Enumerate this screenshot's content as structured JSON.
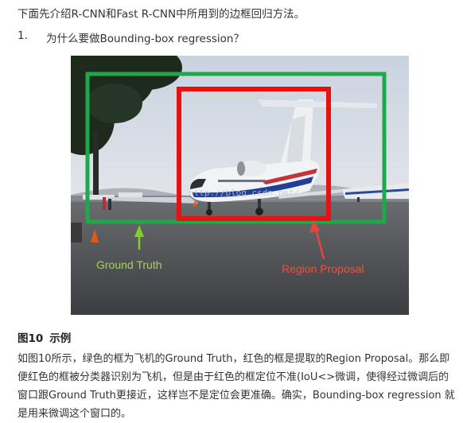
{
  "intro": "下面先介绍R-CNN和Fast R-CNN中所用到的边框回归方法。",
  "question": {
    "number": "1.",
    "text": "为什么要做Bounding-box regression？"
  },
  "figure": {
    "labels": {
      "ground_truth": "Ground Truth",
      "region_proposal": "Region Proposal"
    },
    "watermark": "http://blog.csdn.net/",
    "colors": {
      "ground_truth": "#1fa84a",
      "region_proposal": "#e81010",
      "gt_arrow": "#7ed321",
      "rp_arrow": "#e6463c"
    }
  },
  "caption": {
    "label": "图10",
    "title": "示例"
  },
  "paragraph": "如图10所示，绿色的框为飞机的Ground Truth，红色的框是提取的Region Proposal。那么即便红色的框被分类器识别为飞机，但是由于红色的框定位不准(IoU<>微调，使得经过微调后的窗口跟Ground Truth更接近，这样岂不是定位会更准确。确实，Bounding-box regression 就是用来微调这个窗口的。"
}
